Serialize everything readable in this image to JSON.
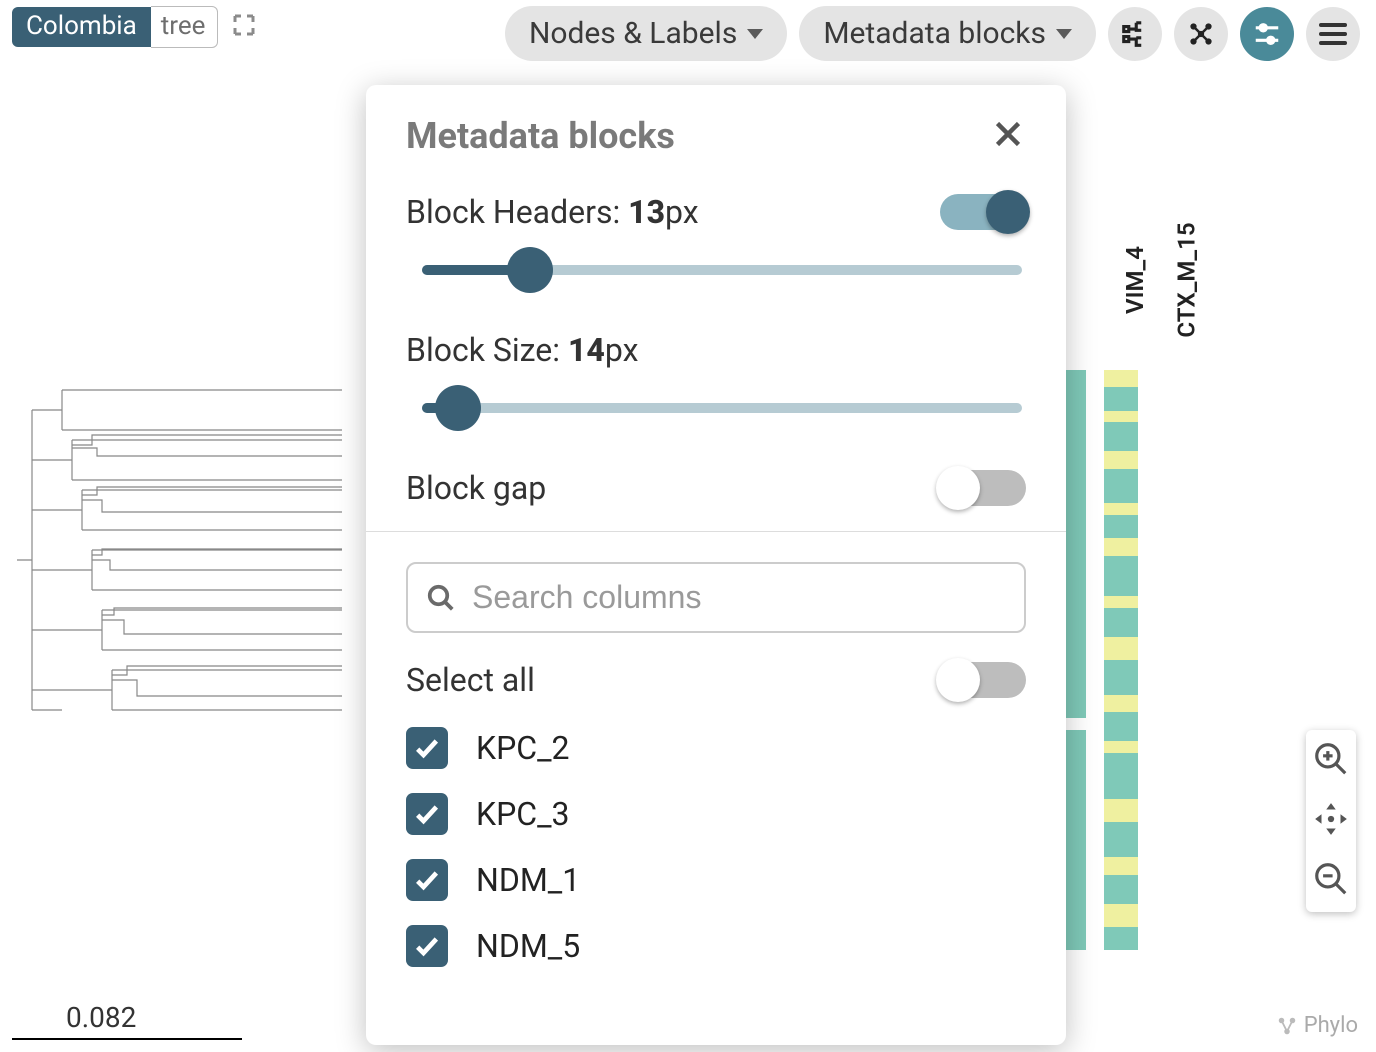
{
  "breadcrumb": {
    "project": "Colombia",
    "view": "tree"
  },
  "toolbar": {
    "nodes_labels": "Nodes & Labels",
    "metadata_blocks": "Metadata blocks"
  },
  "panel": {
    "title": "Metadata blocks",
    "block_headers_label": "Block Headers: ",
    "block_headers_value": "13",
    "block_headers_unit": "px",
    "block_headers_on": true,
    "block_headers_slider_pct": 18,
    "block_size_label": "Block Size: ",
    "block_size_value": "14",
    "block_size_unit": "px",
    "block_size_slider_pct": 6,
    "block_gap_label": "Block gap",
    "block_gap_on": false,
    "search_placeholder": "Search columns",
    "select_all_label": "Select all",
    "select_all_on": false,
    "columns": [
      {
        "label": "KPC_2",
        "checked": true
      },
      {
        "label": "KPC_3",
        "checked": true
      },
      {
        "label": "NDM_1",
        "checked": true
      },
      {
        "label": "NDM_5",
        "checked": true
      }
    ]
  },
  "heatmap": {
    "labels": [
      "VIM_4",
      "CTX_M_15"
    ]
  },
  "scale": "0.082",
  "watermark": "Phylo"
}
